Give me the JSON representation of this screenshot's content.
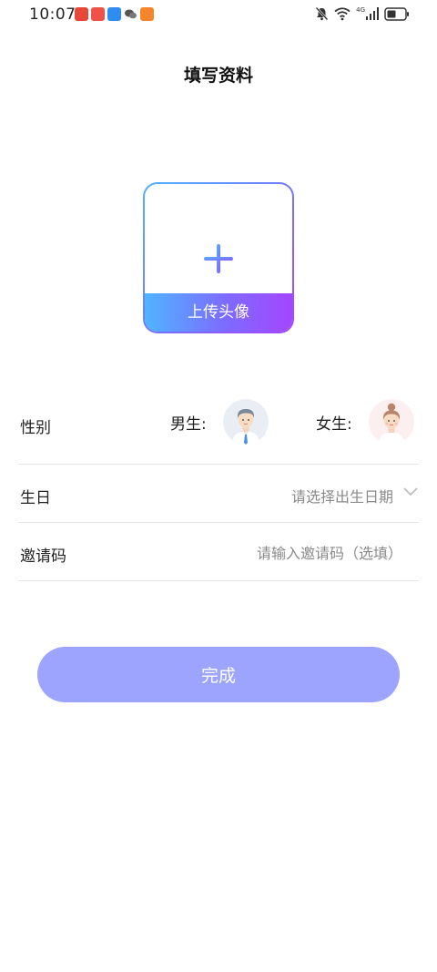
{
  "status_bar": {
    "time": "10:07",
    "app_icons": [
      {
        "name": "red-bear-app-icon",
        "color": "#e8483a"
      },
      {
        "name": "red-book-app-icon",
        "color": "#f0524a"
      },
      {
        "name": "cloud-app-icon",
        "color": "#2f8cf0"
      },
      {
        "name": "wechat-icon",
        "color": "#555555"
      },
      {
        "name": "game-app-icon",
        "color": "#f5852a"
      }
    ],
    "network_label": "4G",
    "system_icons": [
      "bell-muted-icon",
      "wifi-icon",
      "signal-icon",
      "battery-icon"
    ]
  },
  "page": {
    "title": "填写资料"
  },
  "avatar_upload": {
    "icon": "plus-icon",
    "label": "上传头像",
    "gradient": [
      "#4fb4ff",
      "#a446ff"
    ]
  },
  "form": {
    "gender": {
      "label": "性别",
      "male_label": "男生:",
      "female_label": "女生:",
      "male_icon": "male-avatar-icon",
      "female_icon": "female-avatar-icon"
    },
    "birthday": {
      "label": "生日",
      "placeholder": "请选择出生日期",
      "icon": "chevron-down-icon"
    },
    "invite": {
      "label": "邀请码",
      "placeholder": "请输入邀请码（选填）",
      "value": ""
    }
  },
  "submit": {
    "label": "完成",
    "color": "#9da4fd"
  },
  "colors": {
    "accent_blue": "#4fb4ff",
    "accent_purple": "#a446ff",
    "divider": "#e6e6e6",
    "muted_text": "#8a8a8a"
  }
}
